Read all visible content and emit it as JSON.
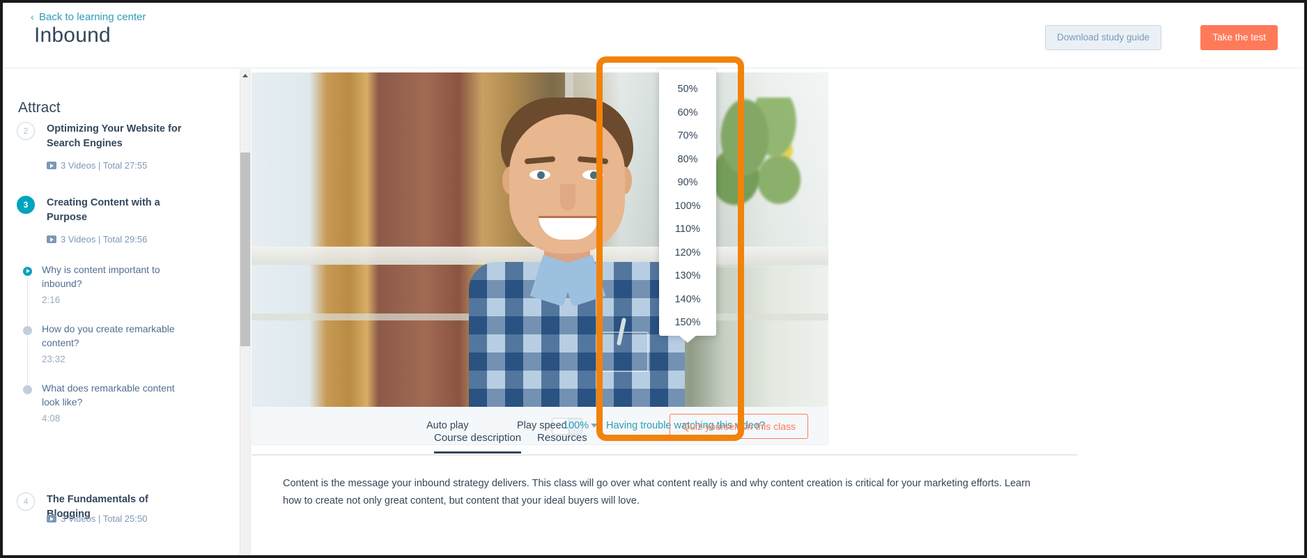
{
  "header": {
    "back_chevron": "‹",
    "back_link": "Back to learning center",
    "title": "Inbound",
    "download_button": "Download study guide",
    "test_button": "Take the test"
  },
  "sidebar": {
    "section_title": "Attract",
    "classes": [
      {
        "number": "2",
        "title": "Optimizing Your Website for Search Engines",
        "meta": "3 Videos | Total 27:55",
        "active": false
      },
      {
        "number": "3",
        "title": "Creating Content with a Purpose",
        "meta": "3 Videos | Total 29:56",
        "active": true
      },
      {
        "number": "4",
        "title": "The Fundamentals of Blogging",
        "meta": "3 Videos | Total 25:50",
        "active": false
      }
    ],
    "lessons": [
      {
        "title": "Why is content important to inbound?",
        "time": "2:16",
        "state": "playing"
      },
      {
        "title": "How do you create remarkable content?",
        "time": "23:32",
        "state": "idle"
      },
      {
        "title": "What does remarkable content look like?",
        "time": "4:08",
        "state": "idle"
      }
    ]
  },
  "player": {
    "auto_play_label": "Auto play",
    "auto_play_on": false,
    "play_speed_label": "Play speed",
    "play_speed_value": "100%",
    "trouble_link": "Having trouble watching this video?",
    "quiz_button": "Quiz yourself on this class",
    "speed_options": [
      "50%",
      "60%",
      "70%",
      "80%",
      "90%",
      "100%",
      "110%",
      "120%",
      "130%",
      "140%",
      "150%"
    ]
  },
  "tabs": [
    {
      "label": "Course description",
      "active": true
    },
    {
      "label": "Resources",
      "active": false
    }
  ],
  "description": "Content is the message your inbound strategy delivers. This class will go over what content really is and why content creation is critical for your marketing efforts. Learn how to create not only great content, but content that your ideal buyers will love.",
  "colors": {
    "accent_teal": "#00a4bd",
    "link_teal": "#2d9cb8",
    "primary_orange": "#ff7a59",
    "highlight_orange": "#f2820a",
    "text_dark": "#33475b"
  }
}
